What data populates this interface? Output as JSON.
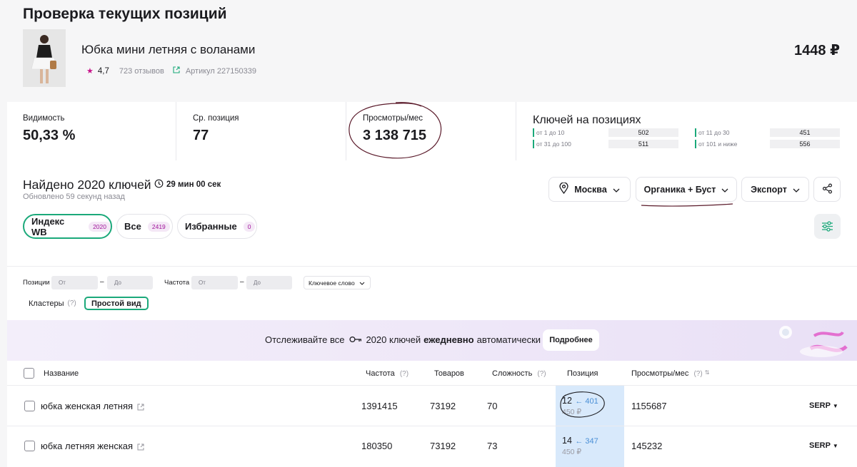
{
  "header": {
    "title": "Проверка текущих позиций"
  },
  "product": {
    "name": "Юбка мини летняя с воланами",
    "rating": "4,7",
    "reviews": "723 отзывов",
    "article": "Артикул 227150339",
    "price": "1448 ₽"
  },
  "stats": {
    "visibility": {
      "label": "Видимость",
      "value": "50,33 %"
    },
    "avg_position": {
      "label": "Ср. позиция",
      "value": "77"
    },
    "views": {
      "label": "Просмотры/мес",
      "value": "3 138 715"
    },
    "keys": {
      "label": "Ключей на позициях",
      "ranges": [
        {
          "label": "от 1 до 10",
          "value": "502"
        },
        {
          "label": "от 11 до 30",
          "value": "451"
        },
        {
          "label": "от 31 до 100",
          "value": "511"
        },
        {
          "label": "от 101 и ниже",
          "value": "556"
        }
      ]
    }
  },
  "found": {
    "title": "Найдено 2020 ключей",
    "timer": "29 мин 00 сек",
    "updated": "Обновлено 59 секунд назад"
  },
  "controls": {
    "city": "Москва",
    "mode": "Органика + Буст",
    "export": "Экспорт"
  },
  "tabs": [
    {
      "label": "Индекс WB",
      "count": "2020",
      "active": true
    },
    {
      "label": "Все",
      "count": "2419",
      "active": false
    },
    {
      "label": "Избранные",
      "count": "0",
      "active": false
    }
  ],
  "filters": {
    "positions_label": "Позиции",
    "frequency_label": "Частота",
    "from_placeholder": "От",
    "to_placeholder": "До",
    "dash": "–",
    "keyword_select": "Ключевое слово",
    "clusters": "Кластеры",
    "clusters_hint": "(?)",
    "simple_view": "Простой вид"
  },
  "banner": {
    "text_before": "Отслеживайте все",
    "text_keys": "2020 ключей",
    "text_bold": "ежедневно",
    "text_after": "автоматически",
    "button": "Подробнее"
  },
  "table": {
    "headers": {
      "name": "Название",
      "freq": "Частота",
      "goods": "Товаров",
      "difficulty": "Сложность",
      "position": "Позиция",
      "views": "Просмотры/мес",
      "hint": "(?)"
    },
    "rows": [
      {
        "name": "юбка женская летняя",
        "freq": "1391415",
        "goods": "73192",
        "difficulty": "70",
        "position": "12",
        "prev": "← 401",
        "price": "450 ₽",
        "views": "1155687",
        "serp": "SERP"
      },
      {
        "name": "юбка летняя женская",
        "freq": "180350",
        "goods": "73192",
        "difficulty": "73",
        "position": "14",
        "prev": "← 347",
        "price": "450 ₽",
        "views": "145232",
        "serp": "SERP"
      }
    ]
  },
  "colors": {
    "accent": "#1ba97a",
    "badge": "#a0139a",
    "position_bg": "#d8e9fb",
    "annotation": "#5a1a2a"
  }
}
